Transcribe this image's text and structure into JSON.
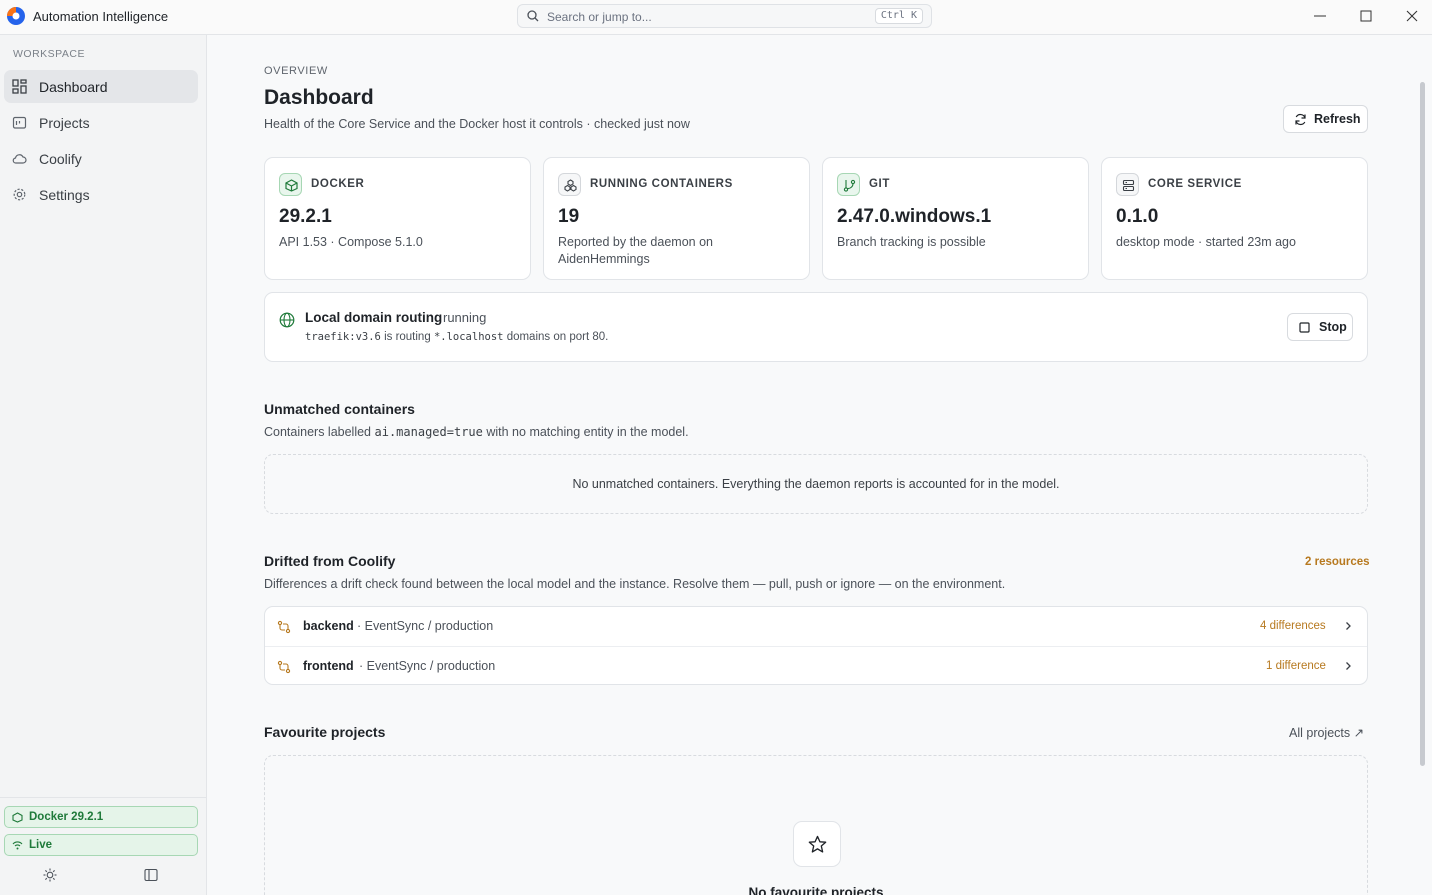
{
  "app": {
    "title": "Automation Intelligence"
  },
  "search": {
    "placeholder": "Search or jump to...",
    "shortcut": "Ctrl K"
  },
  "sidebar": {
    "section_label": "WORKSPACE",
    "items": [
      {
        "label": "Dashboard",
        "icon": "dashboard-icon",
        "active": true
      },
      {
        "label": "Projects",
        "icon": "projects-icon",
        "active": false
      },
      {
        "label": "Coolify",
        "icon": "cloud-icon",
        "active": false
      },
      {
        "label": "Settings",
        "icon": "gear-icon",
        "active": false
      }
    ],
    "status": {
      "docker": "Docker 29.2.1",
      "live": "Live"
    }
  },
  "header": {
    "overline": "OVERVIEW",
    "title": "Dashboard",
    "subtitle": "Health of the Core Service and the Docker host it controls · checked just now",
    "refresh_label": "Refresh"
  },
  "cards": [
    {
      "title": "DOCKER",
      "value": "29.2.1",
      "desc": "API 1.53 · Compose 5.1.0",
      "icon": "docker-icon"
    },
    {
      "title": "RUNNING CONTAINERS",
      "value": "19",
      "desc": "Reported by the daemon on AidenHemmings",
      "icon": "containers-icon"
    },
    {
      "title": "GIT",
      "value": "2.47.0.windows.1",
      "desc": "Branch tracking is possible",
      "icon": "git-branch-icon"
    },
    {
      "title": "CORE SERVICE",
      "value": "0.1.0",
      "desc": "desktop mode · started 23m ago",
      "icon": "server-icon"
    }
  ],
  "routing": {
    "title": "Local domain routing",
    "status": "running",
    "image": "traefik:v3.6",
    "text1": "is routing",
    "domain": "*.localhost",
    "text2": "domains on port 80.",
    "stop_label": "Stop"
  },
  "unmatched": {
    "title": "Unmatched containers",
    "desc_pre": "Containers labelled",
    "desc_code": "ai.managed=true",
    "desc_post": "with no matching entity in the model.",
    "empty": "No unmatched containers. Everything the daemon reports is accounted for in the model."
  },
  "drift": {
    "title": "Drifted from Coolify",
    "count_label": "2 resources",
    "desc": "Differences a drift check found between the local model and the instance. Resolve them — pull, push or ignore — on the environment.",
    "rows": [
      {
        "name": "backend",
        "path": "· EventSync / production",
        "diff": "4 differences"
      },
      {
        "name": "frontend",
        "path": "· EventSync / production",
        "diff": "1 difference"
      }
    ]
  },
  "favourites": {
    "title": "Favourite projects",
    "all_link": "All projects ↗",
    "empty": "No favourite projects"
  },
  "colors": {
    "accent_green": "#1f7a3a",
    "amber": "#b7791f",
    "border": "#e1e4e8"
  }
}
